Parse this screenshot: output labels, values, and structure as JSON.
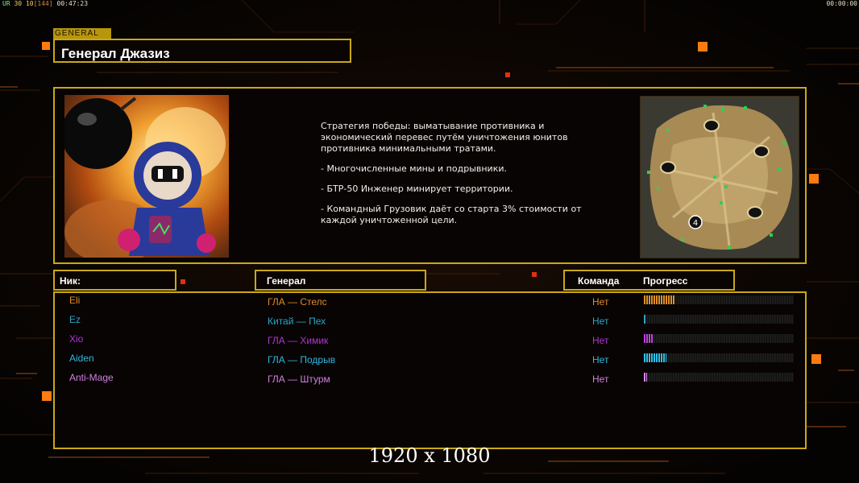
{
  "hud": {
    "top_left_parts": [
      "UR",
      "30",
      "10",
      "[144]",
      "00:47:23"
    ],
    "top_right": "00:00:00"
  },
  "general": {
    "tab_label": "GENERAL",
    "name": "Генерал Джазиз",
    "portrait_icon": "bomberman-portrait-icon",
    "map_icon": "minimap-icon",
    "map_marker": "4",
    "description": [
      "Стратегия победы: выматывание противника и экономический перевес путём уничтожения юнитов противника минимальными тратами.",
      "- Многочисленные мины и подрывники.",
      "- БТР-50 Инженер минирует территории.",
      "- Командный Грузовик даёт со старта 3% стоимости от каждой уничтоженной цели."
    ]
  },
  "table": {
    "headers": {
      "nick": "Ник:",
      "general": "Генерал",
      "team": "Команда",
      "progress": "Прогресс"
    },
    "rows": [
      {
        "nick": "Eli",
        "general": "ГЛА — Стелс",
        "team": "Нет",
        "progress": 0.21,
        "nick_color": "#e08a2a",
        "general_color": "#e08a2a",
        "team_color": "#e08a2a",
        "bar_color": "#e0902a"
      },
      {
        "nick": "Ez",
        "general": "Китай — Пех",
        "team": "Нет",
        "progress": 0.01,
        "nick_color": "#2aa6c8",
        "general_color": "#2aa6c8",
        "team_color": "#2aa6c8",
        "bar_color": "#2aa6c8"
      },
      {
        "nick": "Xio",
        "general": "ГЛА — Химик",
        "team": "Нет",
        "progress": 0.06,
        "nick_color": "#b434d8",
        "general_color": "#b434d8",
        "team_color": "#b434d8",
        "bar_color": "#c040e0"
      },
      {
        "nick": "Aiden",
        "general": "ГЛА — Подрыв",
        "team": "Нет",
        "progress": 0.15,
        "nick_color": "#30b8e0",
        "general_color": "#30b8e0",
        "team_color": "#30b8e0",
        "bar_color": "#30c0ea"
      },
      {
        "nick": "Anti-Mage",
        "general": "ГЛА — Штурм",
        "team": "Нет",
        "progress": 0.02,
        "nick_color": "#d080e0",
        "general_color": "#d080e0",
        "team_color": "#d080e0",
        "bar_color": "#d88ae8"
      }
    ]
  },
  "footer": {
    "resolution": "1920 x 1080"
  }
}
